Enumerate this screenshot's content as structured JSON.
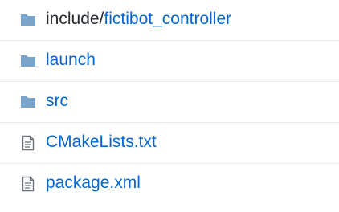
{
  "files": [
    {
      "type": "folder",
      "icon": "folder-icon",
      "prefix": "include/",
      "name": "fictibot_controller"
    },
    {
      "type": "folder",
      "icon": "folder-icon",
      "prefix": "",
      "name": "launch"
    },
    {
      "type": "folder",
      "icon": "folder-icon",
      "prefix": "",
      "name": "src"
    },
    {
      "type": "file",
      "icon": "file-text-icon",
      "prefix": "",
      "name": "CMakeLists.txt"
    },
    {
      "type": "file",
      "icon": "file-text-icon",
      "prefix": "",
      "name": "package.xml"
    }
  ],
  "colors": {
    "folder_icon": "#79a5cc",
    "file_icon": "#6a737d",
    "link": "#0366d6",
    "text": "#24292e",
    "divider": "#e7eaee"
  }
}
